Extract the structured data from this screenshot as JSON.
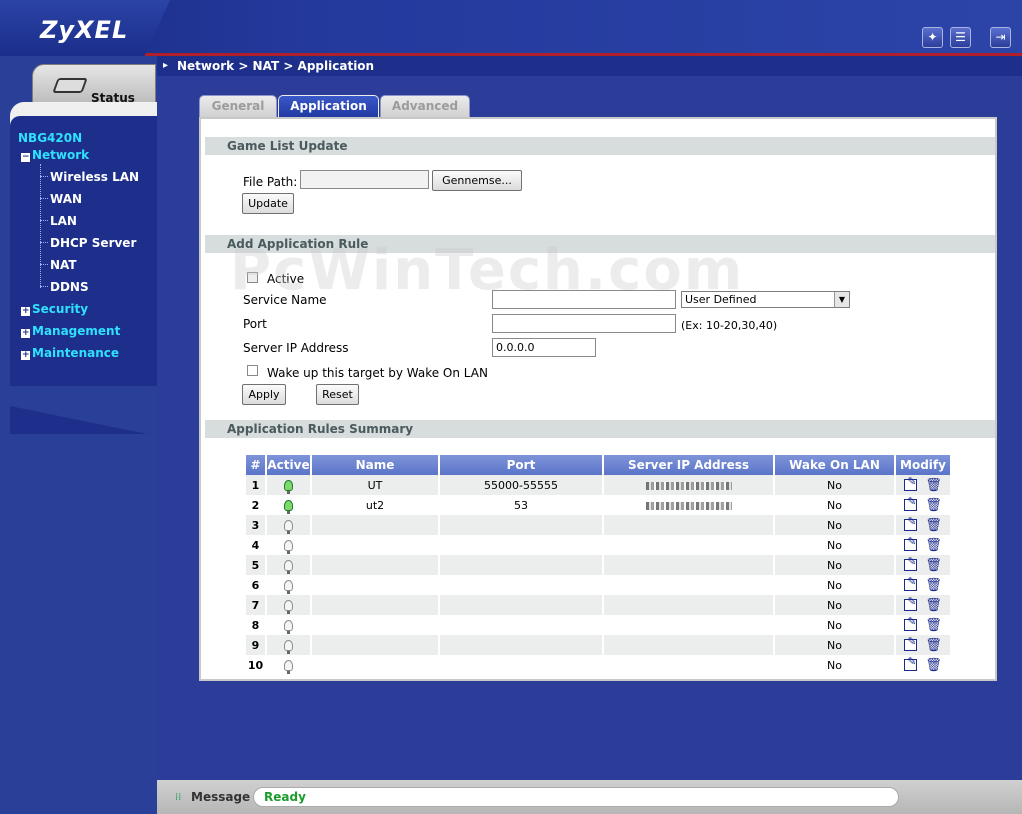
{
  "header": {
    "logo": "ZyXEL",
    "icons": [
      "wizard-icon",
      "notes-icon",
      "logout-icon"
    ]
  },
  "sidebar": {
    "status_label": "Status",
    "device": "NBG420N",
    "network": {
      "label": "Network",
      "children": [
        "Wireless LAN",
        "WAN",
        "LAN",
        "DHCP Server",
        "NAT",
        "DDNS"
      ]
    },
    "security": "Security",
    "management": "Management",
    "maintenance": "Maintenance"
  },
  "breadcrumb": "Network > NAT > Application",
  "tabs": [
    {
      "label": "General",
      "active": false
    },
    {
      "label": "Application",
      "active": true
    },
    {
      "label": "Advanced",
      "active": false
    }
  ],
  "game_list": {
    "title": "Game List Update",
    "file_path_label": "File Path:",
    "file_path_value": "",
    "browse_label": "Gennemse...",
    "update_label": "Update"
  },
  "add_rule": {
    "title": "Add Application Rule",
    "active_label": "Active",
    "service_name_label": "Service Name",
    "service_name_value": "",
    "service_select": "User Defined",
    "port_label": "Port",
    "port_value": "",
    "port_hint": "(Ex: 10-20,30,40)",
    "server_ip_label": "Server IP Address",
    "server_ip_value": "0.0.0.0",
    "wol_label": "Wake up this target by Wake On LAN",
    "apply_label": "Apply",
    "reset_label": "Reset"
  },
  "summary": {
    "title": "Application Rules Summary",
    "columns": [
      "#",
      "Active",
      "Name",
      "Port",
      "Server IP Address",
      "Wake On LAN",
      "Modify"
    ],
    "rows": [
      {
        "num": "1",
        "active": true,
        "name": "UT",
        "port": "55000-55555",
        "ip_redacted": true,
        "wol": "No"
      },
      {
        "num": "2",
        "active": true,
        "name": "ut2",
        "port": "53",
        "ip_redacted": true,
        "wol": "No"
      },
      {
        "num": "3",
        "active": false,
        "name": "",
        "port": "",
        "ip_redacted": false,
        "wol": "No"
      },
      {
        "num": "4",
        "active": false,
        "name": "",
        "port": "",
        "ip_redacted": false,
        "wol": "No"
      },
      {
        "num": "5",
        "active": false,
        "name": "",
        "port": "",
        "ip_redacted": false,
        "wol": "No"
      },
      {
        "num": "6",
        "active": false,
        "name": "",
        "port": "",
        "ip_redacted": false,
        "wol": "No"
      },
      {
        "num": "7",
        "active": false,
        "name": "",
        "port": "",
        "ip_redacted": false,
        "wol": "No"
      },
      {
        "num": "8",
        "active": false,
        "name": "",
        "port": "",
        "ip_redacted": false,
        "wol": "No"
      },
      {
        "num": "9",
        "active": false,
        "name": "",
        "port": "",
        "ip_redacted": false,
        "wol": "No"
      },
      {
        "num": "10",
        "active": false,
        "name": "",
        "port": "",
        "ip_redacted": false,
        "wol": "No"
      }
    ]
  },
  "watermark": "PcWinTech.com",
  "statusbar": {
    "message_label": "Message",
    "message_value": "Ready"
  }
}
